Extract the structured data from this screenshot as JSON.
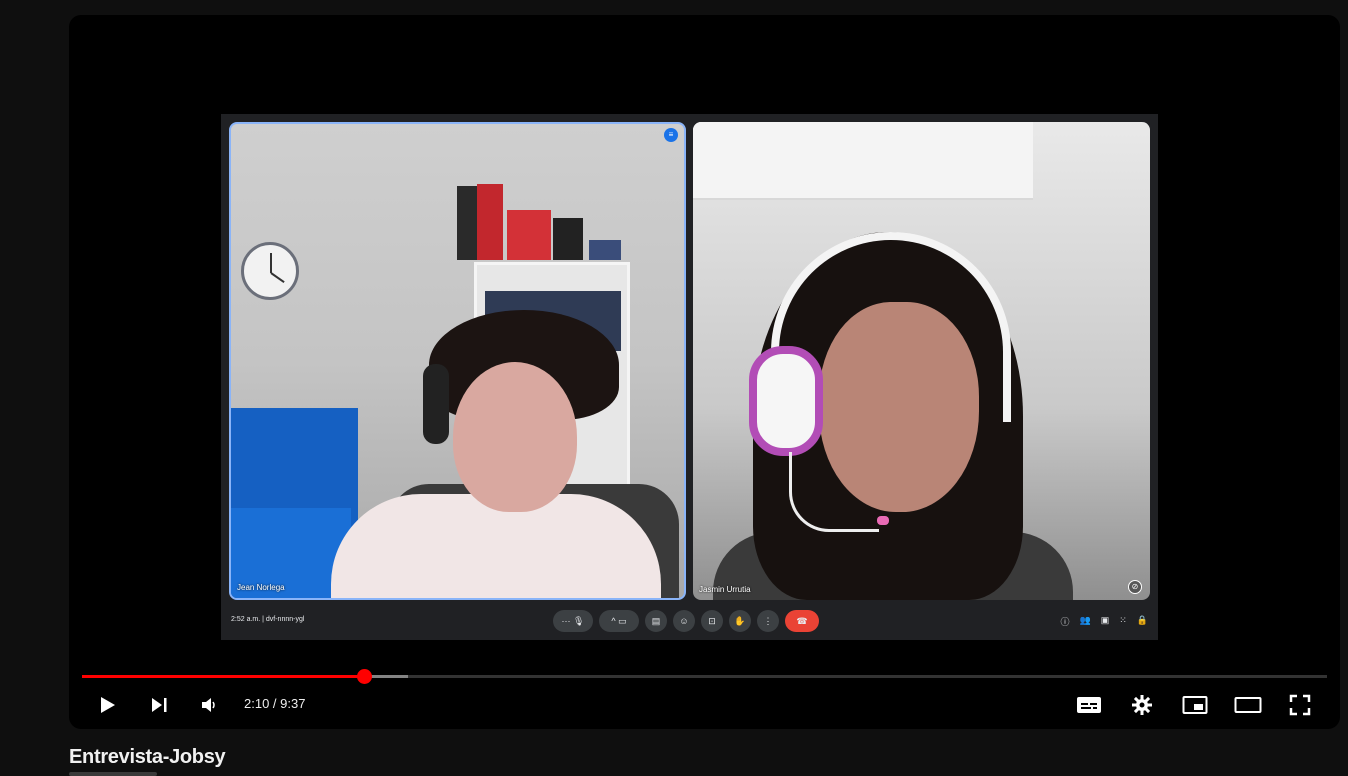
{
  "video": {
    "title": "Entrevista-Jobsy",
    "time_current": "2:10",
    "time_total": "9:37",
    "time_display": "2:10 / 9:37",
    "progress_played": 0.2265,
    "progress_buffered": 0.2615
  },
  "meeting": {
    "participants": [
      {
        "name": "Jean Norlega",
        "speaking": true
      },
      {
        "name": "Jasmin Urrutia",
        "speaking": false
      }
    ],
    "clock": "2:52 a.m.",
    "code": "dvf-nnnn-ygl",
    "info_line": "2:52 a.m.  |  dvf-nnnn-ygl",
    "people_count": "2"
  },
  "controls": {
    "play": "play-icon",
    "next": "next-icon",
    "volume": "volume-icon",
    "subtitles": "subtitles-icon",
    "settings": "gear-icon",
    "miniplayer": "miniplayer-icon",
    "theater": "theater-icon",
    "fullscreen": "fullscreen-icon"
  },
  "colors": {
    "progress": "#ff0000",
    "background": "#0f0f0f",
    "speaking_border": "#8ab4f8",
    "end_call": "#ea4335"
  }
}
